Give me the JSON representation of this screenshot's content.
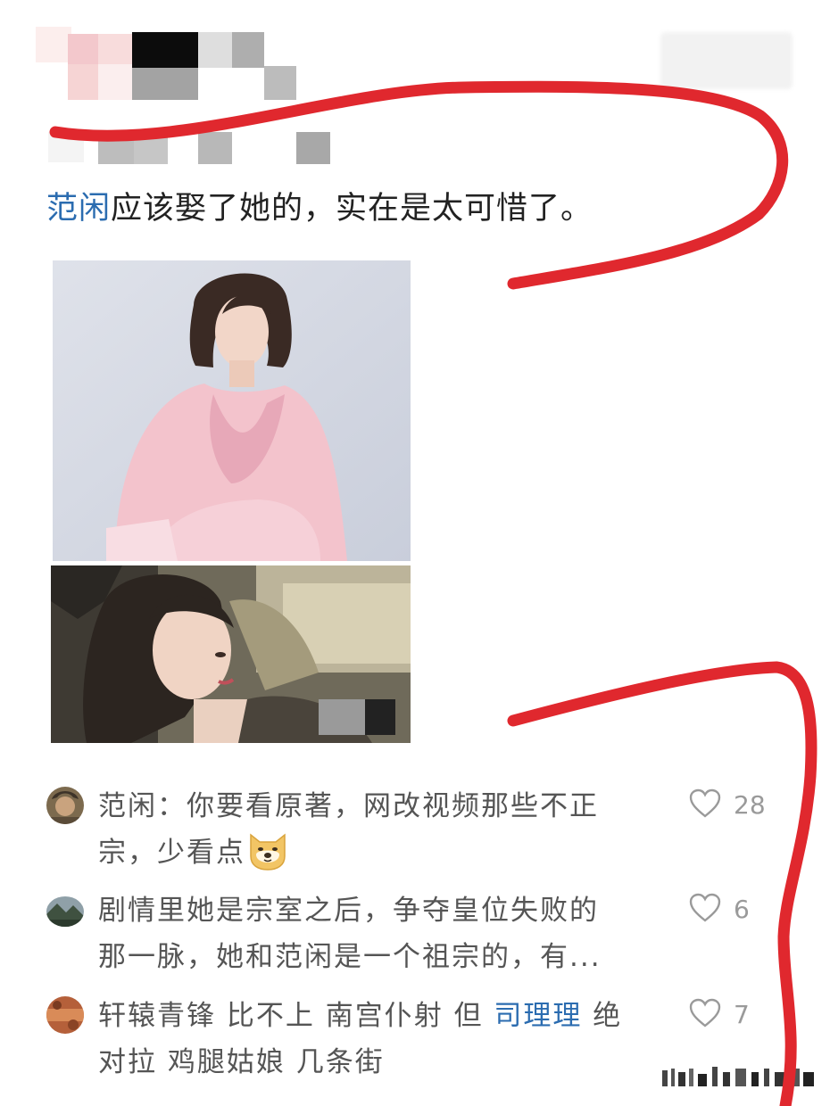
{
  "post": {
    "mention": "范闲",
    "text": "应该娶了她的，实在是太可惜了。"
  },
  "comments": [
    {
      "line1": "范闲：你要看原著，网改视频那些不正",
      "line2": "宗，少看点",
      "emoji": "doge-emoji",
      "likes": "28"
    },
    {
      "line1": "剧情里她是宗室之后，争夺皇位失败的",
      "line2": "那一脉，她和范闲是一个祖宗的，有...",
      "likes": "6"
    },
    {
      "line1_a": "轩辕青锋 比不上 南宫仆射 但 ",
      "line1_link": "司理理",
      "line1_b": " 绝",
      "line2": "对拉 鸡腿姑娘 几条街",
      "likes": "7"
    }
  ],
  "colors": {
    "mention": "#2b6cb0",
    "annotation": "#e0282e",
    "comment_text": "#555555",
    "like_icon": "#9a9a9a"
  },
  "icons": [
    "heart-outline-icon",
    "doge-emoji"
  ]
}
